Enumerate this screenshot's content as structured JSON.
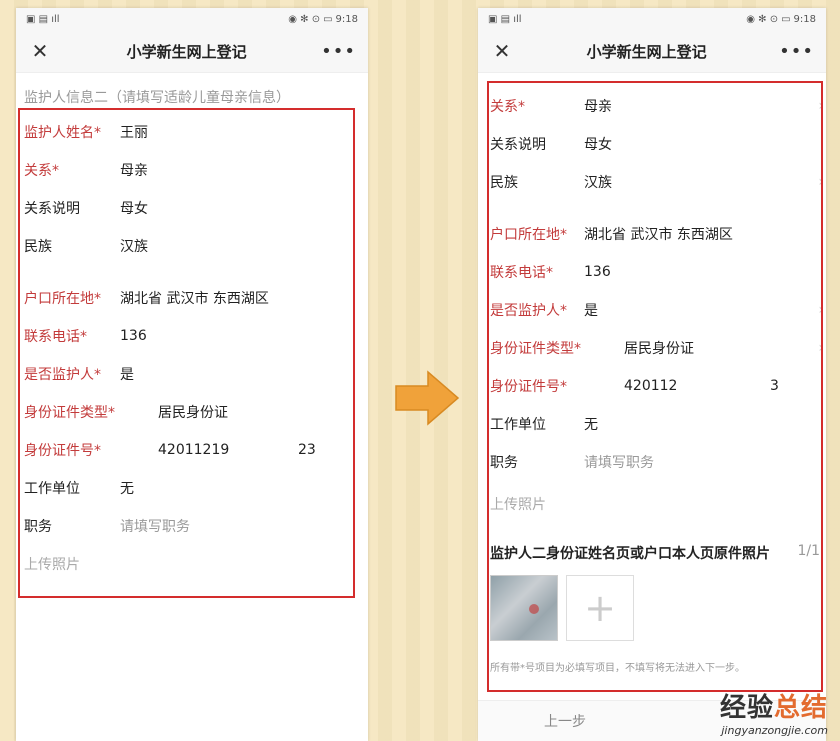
{
  "status_bar": {
    "time": "9:18",
    "battery": "45"
  },
  "app": {
    "title": "小学新生网上登记",
    "close_icon": "close-icon",
    "more_icon": "more-icon"
  },
  "left": {
    "section_heading": "监护人信息二（请填写适龄儿童母亲信息）",
    "fields": {
      "name": {
        "label": "监护人姓名*",
        "value": "王丽"
      },
      "relation": {
        "label": "关系*",
        "value": "母亲"
      },
      "relation_desc": {
        "label": "关系说明",
        "value": "母女"
      },
      "ethnicity": {
        "label": "民族",
        "value": "汉族"
      },
      "hukou": {
        "label": "户口所在地*",
        "value": "湖北省 武汉市 东西湖区"
      },
      "phone": {
        "label": "联系电话*",
        "value": "136"
      },
      "is_guardian": {
        "label": "是否监护人*",
        "value": "是"
      },
      "id_type": {
        "label": "身份证件类型*",
        "value": "居民身份证"
      },
      "id_number": {
        "label": "身份证件号*",
        "value_prefix": "42011219",
        "value_suffix": "23"
      },
      "employer": {
        "label": "工作单位",
        "value": "无"
      },
      "job": {
        "label": "职务",
        "placeholder": "请填写职务"
      },
      "upload": {
        "label": "上传照片"
      }
    }
  },
  "right": {
    "fields": {
      "relation": {
        "label": "关系*",
        "value": "母亲"
      },
      "relation_desc": {
        "label": "关系说明",
        "value": "母女"
      },
      "ethnicity": {
        "label": "民族",
        "value": "汉族"
      },
      "hukou": {
        "label": "户口所在地*",
        "value": "湖北省 武汉市 东西湖区"
      },
      "phone": {
        "label": "联系电话*",
        "value": "136"
      },
      "is_guardian": {
        "label": "是否监护人*",
        "value": "是"
      },
      "id_type": {
        "label": "身份证件类型*",
        "value": "居民身份证"
      },
      "id_number": {
        "label": "身份证件号*",
        "value_prefix": "420112",
        "value_suffix": "3"
      },
      "employer": {
        "label": "工作单位",
        "value": "无"
      },
      "job": {
        "label": "职务",
        "placeholder": "请填写职务"
      },
      "upload": {
        "label": "上传照片"
      }
    },
    "photos": {
      "title": "监护人二身份证姓名页或户口本人页原件照片",
      "count": "1/1",
      "add_icon": "plus-icon"
    },
    "note": "所有带*号项目为必填写项目，不填写将无法进入下一步。",
    "prev_button": "上一步"
  },
  "watermark": {
    "cn_part1": "经验",
    "cn_part2": "总结",
    "en": "jingyanzongjie.com"
  },
  "colors": {
    "required": "#c33b3b",
    "frame": "#d42d2d",
    "arrow": "#f0a23a"
  }
}
